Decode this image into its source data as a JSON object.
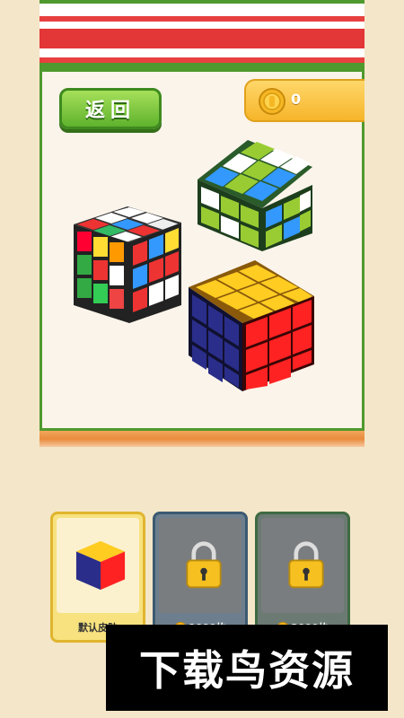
{
  "header": {
    "back_label": "返回",
    "coins": "0"
  },
  "colors": {
    "frame_green": "#4f9a2e",
    "coin_gold": "#f6b52a",
    "button_green": "#5fb22d"
  },
  "skins": [
    {
      "label": "默认皮肤",
      "locked": false
    },
    {
      "label": "1000枚",
      "locked": true,
      "icon": "coin-icon"
    },
    {
      "label": "2000枚",
      "locked": true,
      "icon": "coin-icon"
    }
  ],
  "watermark": "下载鸟资源"
}
